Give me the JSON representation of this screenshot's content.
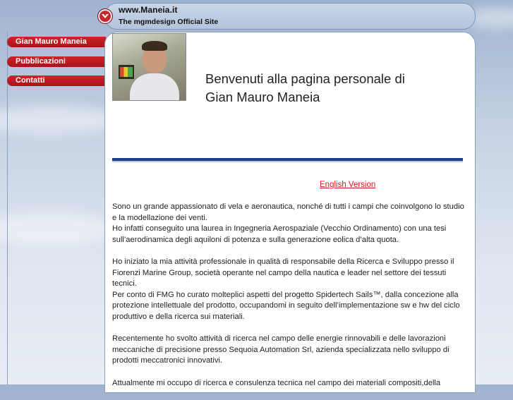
{
  "header": {
    "title": "www.Maneia.it",
    "subtitle": "The mgmdesign Official Site"
  },
  "nav": [
    {
      "label": "Gian Mauro Maneia"
    },
    {
      "label": "Pubblicazioni"
    },
    {
      "label": "Contatti"
    }
  ],
  "main": {
    "welcome_line1": "Benvenuti alla pagina personale di",
    "welcome_line2": "Gian Mauro Maneia",
    "english_link": "English Version",
    "paragraphs": [
      "Sono un grande appassionato di vela e aeronautica, nonché di tutti i campi che coinvolgono lo studio e la modellazione dei venti.\nHo infatti conseguito una laurea in Ingegneria Aerospaziale (Vecchio Ordinamento) con una tesi sull’aerodinamica degli aquiloni di potenza e sulla generazione eolica d’alta quota.",
      "Ho iniziato la mia attività professionale in qualità di responsabile della Ricerca e Sviluppo presso il Fiorenzi Marine Group, società operante nel campo della nautica e leader nel settore dei tessuti tecnici.\nPer conto di FMG ho curato molteplici aspetti del progetto Spidertech Sails™, dalla concezione alla protezione intellettuale del prodotto, occupandomi in seguito dell’implementazione sw e hw del ciclo produttivo e della ricerca sui materiali.",
      "Recentemente ho svolto attività di ricerca nel campo delle energie rinnovabili e delle lavorazioni meccaniche di precisione presso Sequoia Automation Srl, azienda specializzata nello sviluppo di prodotti meccatronici innovativi.",
      "Attualmente mi occupo di ricerca e consulenza tecnica nel campo dei materiali compositi,della"
    ]
  }
}
